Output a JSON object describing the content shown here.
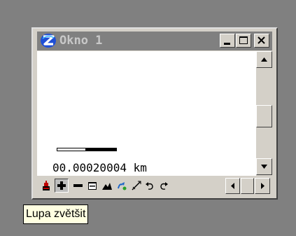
{
  "window": {
    "title": "Okno 1",
    "app_icon": "stylized-z-logo-icon",
    "controls": [
      "minimize-icon",
      "maximize-icon",
      "close-icon"
    ]
  },
  "map": {
    "scale_text": "00.00020004 km"
  },
  "toolbar": {
    "tools": [
      {
        "name": "pointer-tool-icon",
        "pressed": false
      },
      {
        "name": "zoom-in-icon",
        "pressed": true
      },
      {
        "name": "zoom-out-icon",
        "pressed": false
      },
      {
        "name": "zoom-window-icon",
        "pressed": false
      },
      {
        "name": "zoom-extent-icon",
        "pressed": false
      },
      {
        "name": "pan-icon",
        "pressed": false
      },
      {
        "name": "measure-icon",
        "pressed": false
      },
      {
        "name": "undo-icon",
        "pressed": false
      },
      {
        "name": "redo-icon",
        "pressed": false
      }
    ]
  },
  "tooltip": {
    "text": "Lupa zvětšit"
  },
  "colors": {
    "face": "#d4d0c8",
    "titlebar_inactive": "#808080",
    "tooltip_bg": "#ffffe1",
    "desktop": "#808080"
  }
}
